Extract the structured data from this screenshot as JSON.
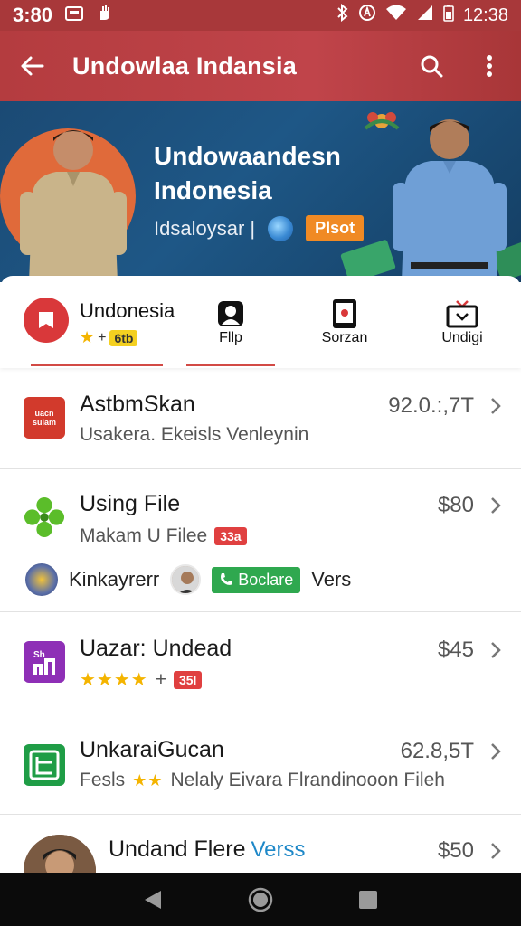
{
  "status_bar": {
    "time": "3:80",
    "clock": "12:38"
  },
  "app_bar": {
    "title": "Undowlaa Indansia",
    "back_icon": "back-arrow-icon",
    "search_icon": "search-icon",
    "more_icon": "more-vert-icon"
  },
  "hero": {
    "headline": "Undowaandesn Indonesia",
    "subtitle": "Idsaloysar |",
    "pill_label": "Plsot"
  },
  "tabs": {
    "items": [
      {
        "label": "Undonesia",
        "badge": "6tb",
        "icon": "flag-icon",
        "selected": true
      },
      {
        "label": "Fllp",
        "icon": "person-icon",
        "selected": true
      },
      {
        "label": "Sorzan",
        "icon": "tablet-icon",
        "selected": false
      },
      {
        "label": "Undigi",
        "icon": "tv-icon",
        "selected": false
      }
    ]
  },
  "list": {
    "items": [
      {
        "title": "AstbmSkan",
        "price": "92.0.:,7T",
        "subtitle": "Usakera.  Ekeisls Venleynin",
        "icon_text": "uacn\nsuiam"
      },
      {
        "title": "Using File",
        "price": "$80",
        "subtitle": "Makam U Filee",
        "badge": "33a",
        "secondary_label": "Kinkayrerr",
        "green_pill": "Boclare",
        "trailing": "Vers"
      },
      {
        "title": "Uazar: Undead",
        "price": "$45",
        "badge": "35l",
        "icon_text": "Sh\nnl"
      },
      {
        "title": "UnkaraiGucan",
        "price": "62.8,5T",
        "subtitle_pre": "Fesls",
        "subtitle_post": "Nelaly Eivara Flrandinooon Fileh"
      },
      {
        "title": "Undand Flere",
        "title_accent": "Verss",
        "price": "$50"
      }
    ]
  },
  "colors": {
    "app_bar": "#b43c3f",
    "accent_red": "#d9383a",
    "hero_blue": "#1e5786",
    "star": "#f4b400",
    "green": "#2fa84f"
  }
}
